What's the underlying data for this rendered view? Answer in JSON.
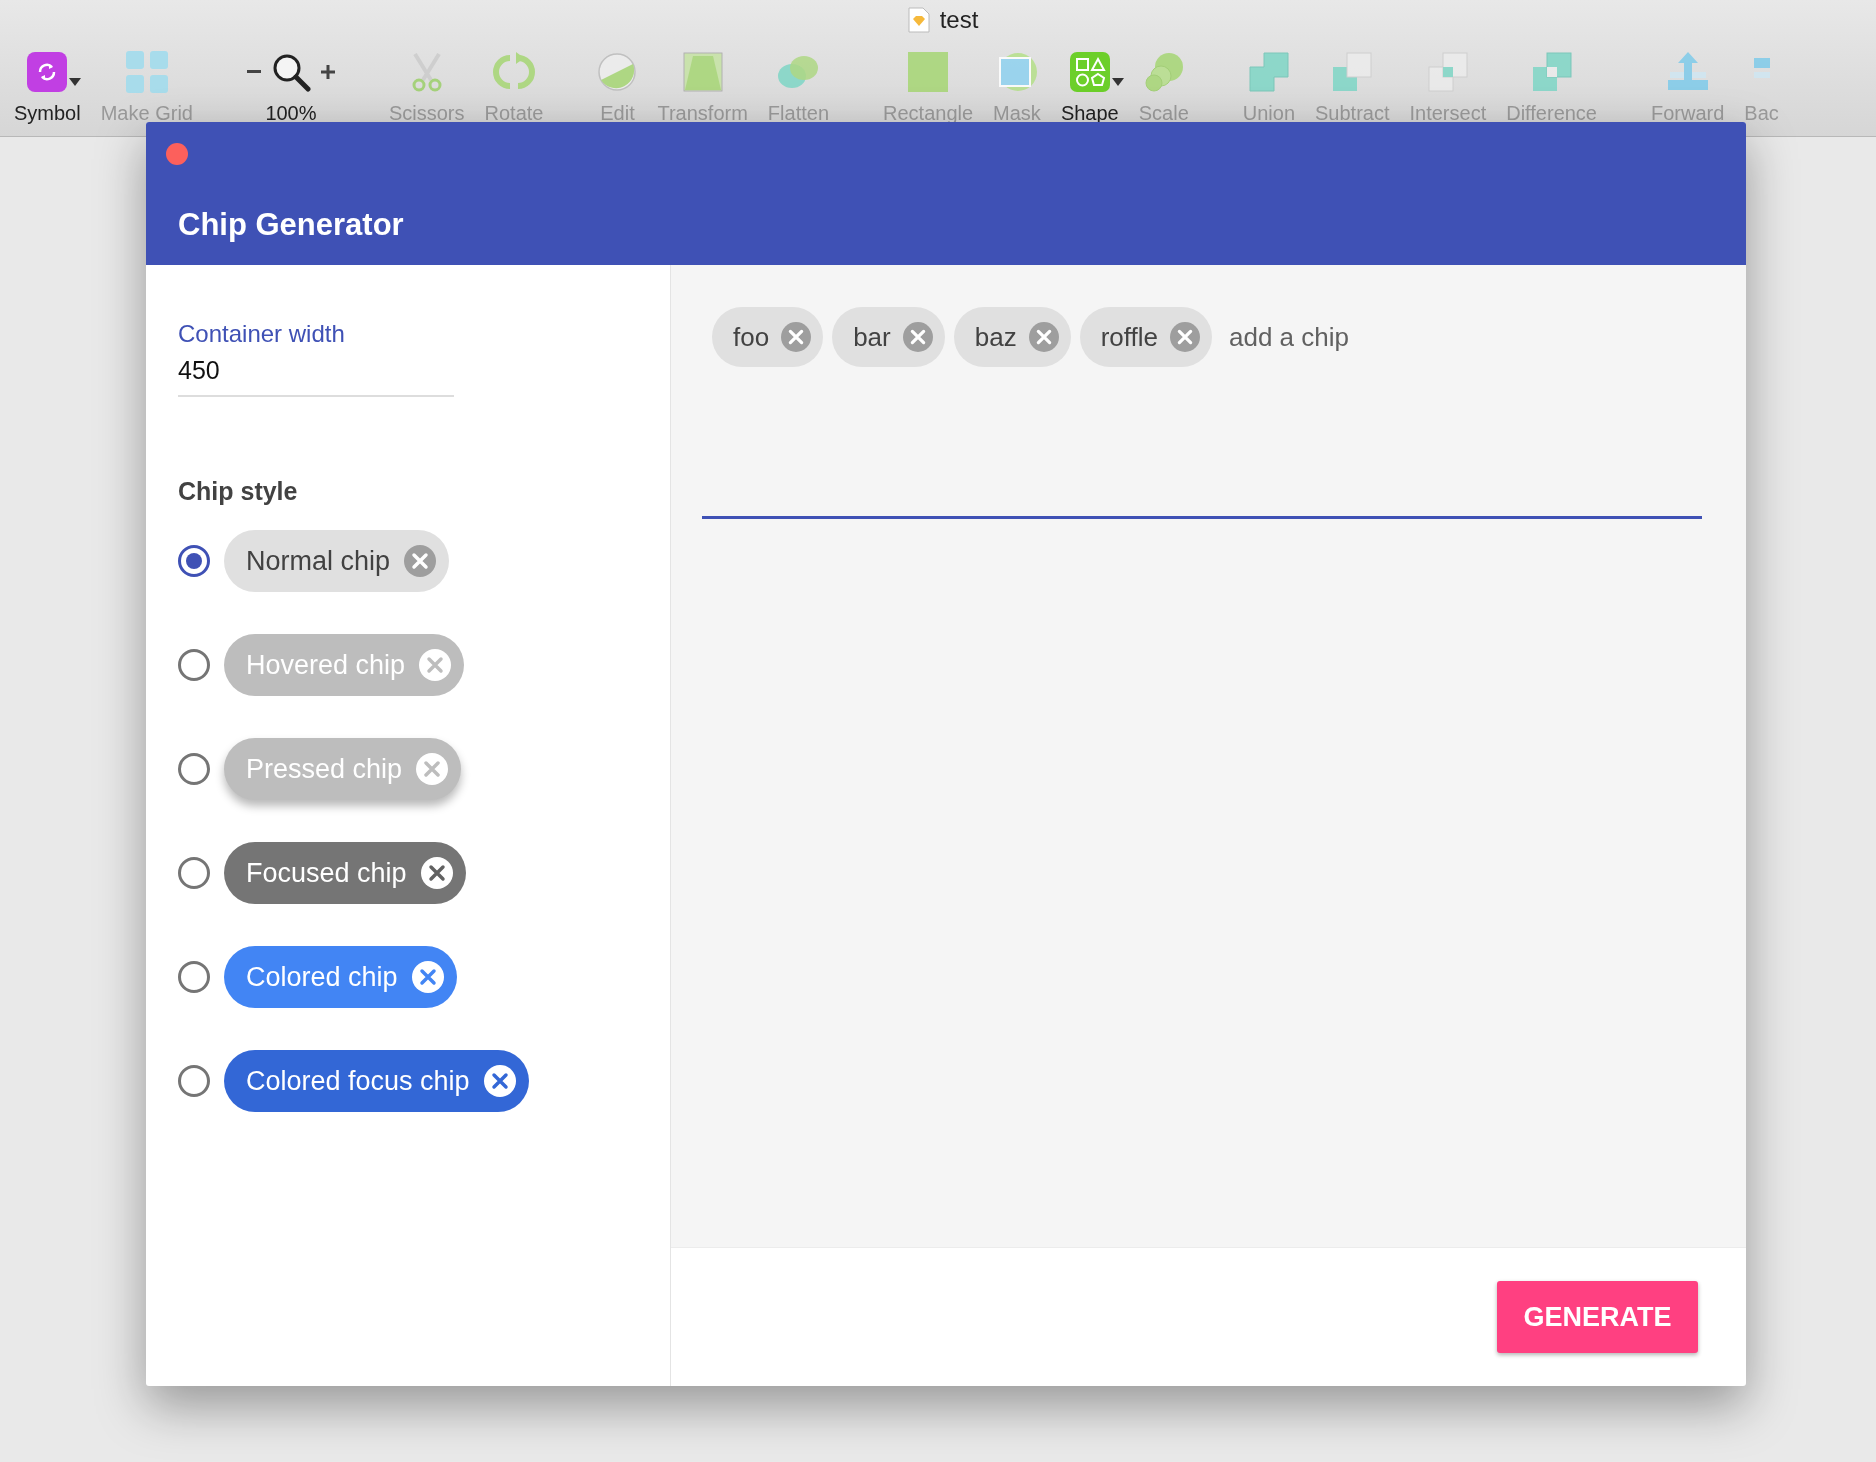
{
  "window": {
    "title": "test"
  },
  "toolbar": {
    "groups": [
      {
        "items": [
          {
            "kind": "symbol",
            "label": "Symbol",
            "disabled": false
          },
          {
            "kind": "grid",
            "label": "Make Grid",
            "disabled": true
          }
        ]
      },
      {
        "items": [
          {
            "kind": "zoom",
            "label": "100%",
            "disabled": false
          }
        ]
      },
      {
        "items": [
          {
            "kind": "scissors",
            "label": "Scissors",
            "disabled": true
          },
          {
            "kind": "rotate",
            "label": "Rotate",
            "disabled": true
          }
        ]
      },
      {
        "items": [
          {
            "kind": "edit",
            "label": "Edit",
            "disabled": true
          },
          {
            "kind": "transform",
            "label": "Transform",
            "disabled": true
          },
          {
            "kind": "flatten",
            "label": "Flatten",
            "disabled": true
          }
        ]
      },
      {
        "items": [
          {
            "kind": "rectangle",
            "label": "Rectangle",
            "disabled": true
          },
          {
            "kind": "mask",
            "label": "Mask",
            "disabled": true
          },
          {
            "kind": "shape",
            "label": "Shape",
            "disabled": false
          },
          {
            "kind": "scale",
            "label": "Scale",
            "disabled": true
          }
        ]
      },
      {
        "items": [
          {
            "kind": "union",
            "label": "Union",
            "disabled": true
          },
          {
            "kind": "subtract",
            "label": "Subtract",
            "disabled": true
          },
          {
            "kind": "intersect",
            "label": "Intersect",
            "disabled": true
          },
          {
            "kind": "difference",
            "label": "Difference",
            "disabled": true
          }
        ]
      },
      {
        "items": [
          {
            "kind": "forward",
            "label": "Forward",
            "disabled": true
          },
          {
            "kind": "backward",
            "label": "Bac",
            "disabled": true
          }
        ]
      }
    ]
  },
  "dialog": {
    "title": "Chip Generator",
    "container_width": {
      "label": "Container width",
      "value": "450"
    },
    "chip_style_heading": "Chip style",
    "chip_styles": [
      {
        "kind": "normal",
        "label": "Normal chip",
        "selected": true
      },
      {
        "kind": "hovered",
        "label": "Hovered chip",
        "selected": false
      },
      {
        "kind": "pressed",
        "label": "Pressed chip",
        "selected": false
      },
      {
        "kind": "focused",
        "label": "Focused chip",
        "selected": false
      },
      {
        "kind": "colored",
        "label": "Colored chip",
        "selected": false
      },
      {
        "kind": "colored_focus",
        "label": "Colored focus chip",
        "selected": false
      }
    ],
    "chip_input": {
      "chips": [
        "foo",
        "bar",
        "baz",
        "roffle"
      ],
      "placeholder": "add a chip"
    },
    "generate_button": "GENERATE"
  }
}
